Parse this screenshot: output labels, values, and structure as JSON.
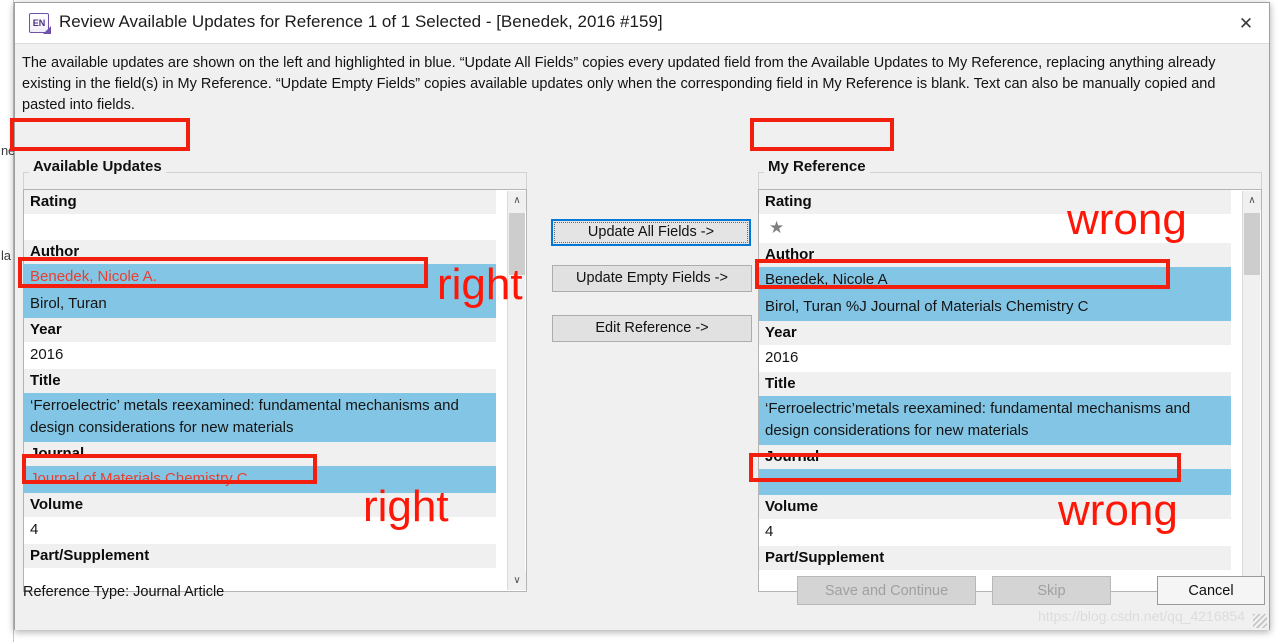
{
  "window": {
    "title": "Review Available Updates for Reference 1 of 1 Selected - [Benedek, 2016 #159]",
    "app_icon_label": "EN",
    "close_icon": "✕"
  },
  "description": "The available updates are shown on the left and highlighted in blue. “Update All Fields” copies every updated field from the Available Updates to My Reference, replacing anything already existing in the field(s) in My Reference. “Update Empty Fields” copies available updates only when the corresponding field in My Reference is blank. Text can also be manually copied and pasted into fields.",
  "left_panel": {
    "legend": "Available Updates",
    "fields": {
      "rating_label": "Rating",
      "rating_value": "",
      "author_label": "Author",
      "author_1": "Benedek, Nicole A.",
      "author_2": "Birol, Turan",
      "year_label": "Year",
      "year_value": "2016",
      "title_label": "Title",
      "title_value": "‘Ferroelectric’ metals reexamined: fundamental mechanisms and design considerations for new materials",
      "journal_label": "Journal",
      "journal_value": "Journal of Materials Chemistry C",
      "volume_label": "Volume",
      "volume_value": "4",
      "part_label": "Part/Supplement"
    },
    "scrollbar": {
      "up_icon": "∧",
      "down_icon": "∨"
    }
  },
  "right_panel": {
    "legend": "My Reference",
    "fields": {
      "rating_label": "Rating",
      "rating_value": "★",
      "author_label": "Author",
      "author_1": "Benedek, Nicole A",
      "author_2": "Birol, Turan %J Journal of Materials Chemistry C",
      "year_label": "Year",
      "year_value": "2016",
      "title_label": "Title",
      "title_value": "‘Ferroelectric’metals reexamined: fundamental mechanisms and design considerations for new materials",
      "journal_label": "Journal",
      "journal_value": "",
      "volume_label": "Volume",
      "volume_value": "4",
      "part_label": "Part/Supplement"
    },
    "scrollbar": {
      "up_icon": "∧",
      "down_icon": "∨"
    }
  },
  "middle_buttons": {
    "update_all": "Update All Fields ->",
    "update_empty": "Update Empty Fields ->",
    "edit_reference": "Edit Reference ->"
  },
  "footer": {
    "reference_type": "Reference Type: Journal Article",
    "save_and_continue": "Save and Continue",
    "skip": "Skip",
    "cancel": "Cancel"
  },
  "annotations": {
    "right_1": "right",
    "right_2": "right",
    "wrong_1": "wrong",
    "wrong_2": "wrong",
    "color": "#fe1606"
  },
  "background": {
    "fragment_top": "ne",
    "fragment_bottom": "la"
  },
  "watermark": "https://blog.csdn.net/qq_4216854",
  "colors": {
    "highlight_blue": "#83c5e5",
    "annotation_red": "#f21e0e",
    "red_text": "#e8402f",
    "focus_blue": "#0078d7"
  }
}
